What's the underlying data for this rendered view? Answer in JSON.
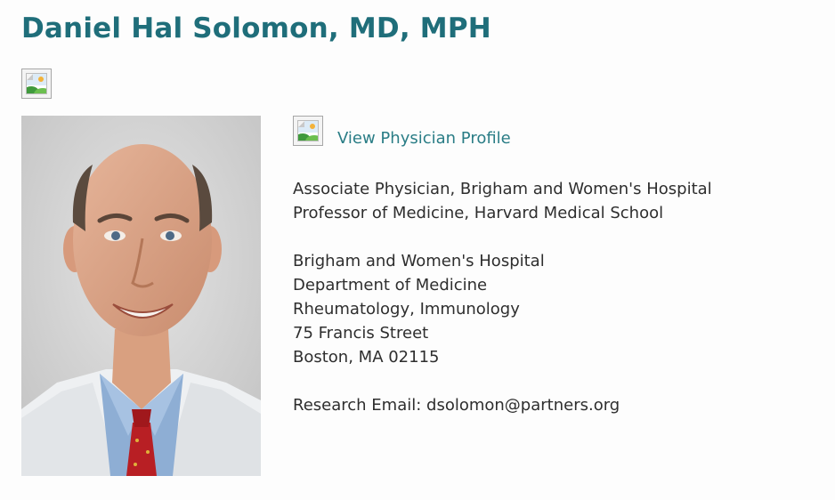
{
  "physician": {
    "name": "Daniel Hal Solomon, MD, MPH",
    "profile_link_label": "View Physician Profile",
    "positions": [
      "Associate Physician, Brigham and Women's Hospital",
      "Professor of Medicine, Harvard Medical School"
    ],
    "address": [
      "Brigham and Women's Hospital",
      "Department of Medicine",
      "Rheumatology, Immunology",
      "75 Francis Street",
      "Boston, MA 02115"
    ],
    "email_line": "Research Email: dsolomon@partners.org"
  },
  "icons": {
    "top_image": "broken-image-icon",
    "profile_image": "broken-image-icon"
  },
  "colors": {
    "title": "#1f6e7a",
    "link": "#2a7d86",
    "body_text": "#2e2e2e",
    "background": "#fdfdfd"
  }
}
